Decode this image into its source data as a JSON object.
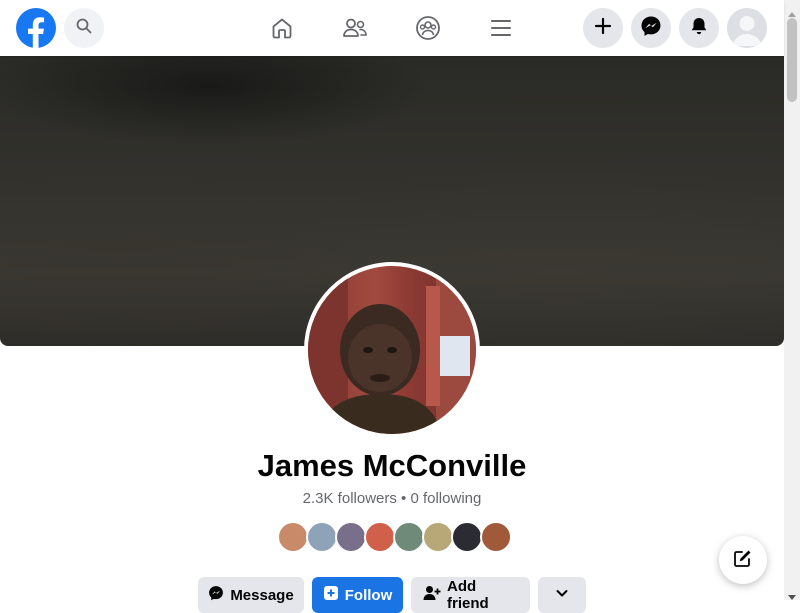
{
  "topbar": {
    "icons": [
      "facebook-logo",
      "search-icon",
      "home-icon",
      "friends-icon",
      "groups-icon",
      "menu-icon",
      "plus-icon",
      "messenger-icon",
      "bell-icon",
      "account-avatar"
    ]
  },
  "profile": {
    "name": "James McConville",
    "stats": "2.3K followers • 0 following"
  },
  "followers_preview": [
    {
      "color": "#c98a6a"
    },
    {
      "color": "#8fa3b8"
    },
    {
      "color": "#7a6f8a"
    },
    {
      "color": "#d0604a"
    },
    {
      "color": "#6f8a78"
    },
    {
      "color": "#b8a878"
    },
    {
      "color": "#2b2b33"
    },
    {
      "color": "#a05a3a"
    }
  ],
  "actions": {
    "message_label": "Message",
    "follow_label": "Follow",
    "add_friend_label": "Add friend"
  },
  "colors": {
    "brand": "#1877f2",
    "follow_button": "#1b74e4",
    "secondary_button": "#e4e6eb"
  }
}
